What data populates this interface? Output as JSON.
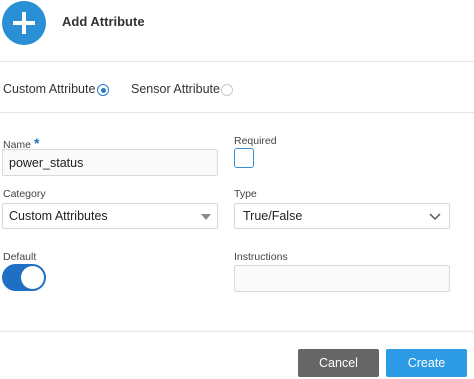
{
  "header": {
    "title": "Add Attribute",
    "icon": "plus-icon",
    "accent_color": "#2b8fd6"
  },
  "attribute_type": {
    "options": [
      {
        "label": "Custom Attribute",
        "selected": true
      },
      {
        "label": "Sensor Attribute",
        "selected": false
      }
    ]
  },
  "form": {
    "name": {
      "label": "Name",
      "required_marker": "*",
      "value": "power_status"
    },
    "required": {
      "label": "Required",
      "checked": false
    },
    "category": {
      "label": "Category",
      "value": "Custom Attributes"
    },
    "type": {
      "label": "Type",
      "value": "True/False"
    },
    "default": {
      "label": "Default",
      "on": true
    },
    "instructions": {
      "label": "Instructions",
      "value": ""
    }
  },
  "actions": {
    "cancel_label": "Cancel",
    "create_label": "Create",
    "cancel_color": "#666666",
    "create_color": "#2d9ae6"
  }
}
